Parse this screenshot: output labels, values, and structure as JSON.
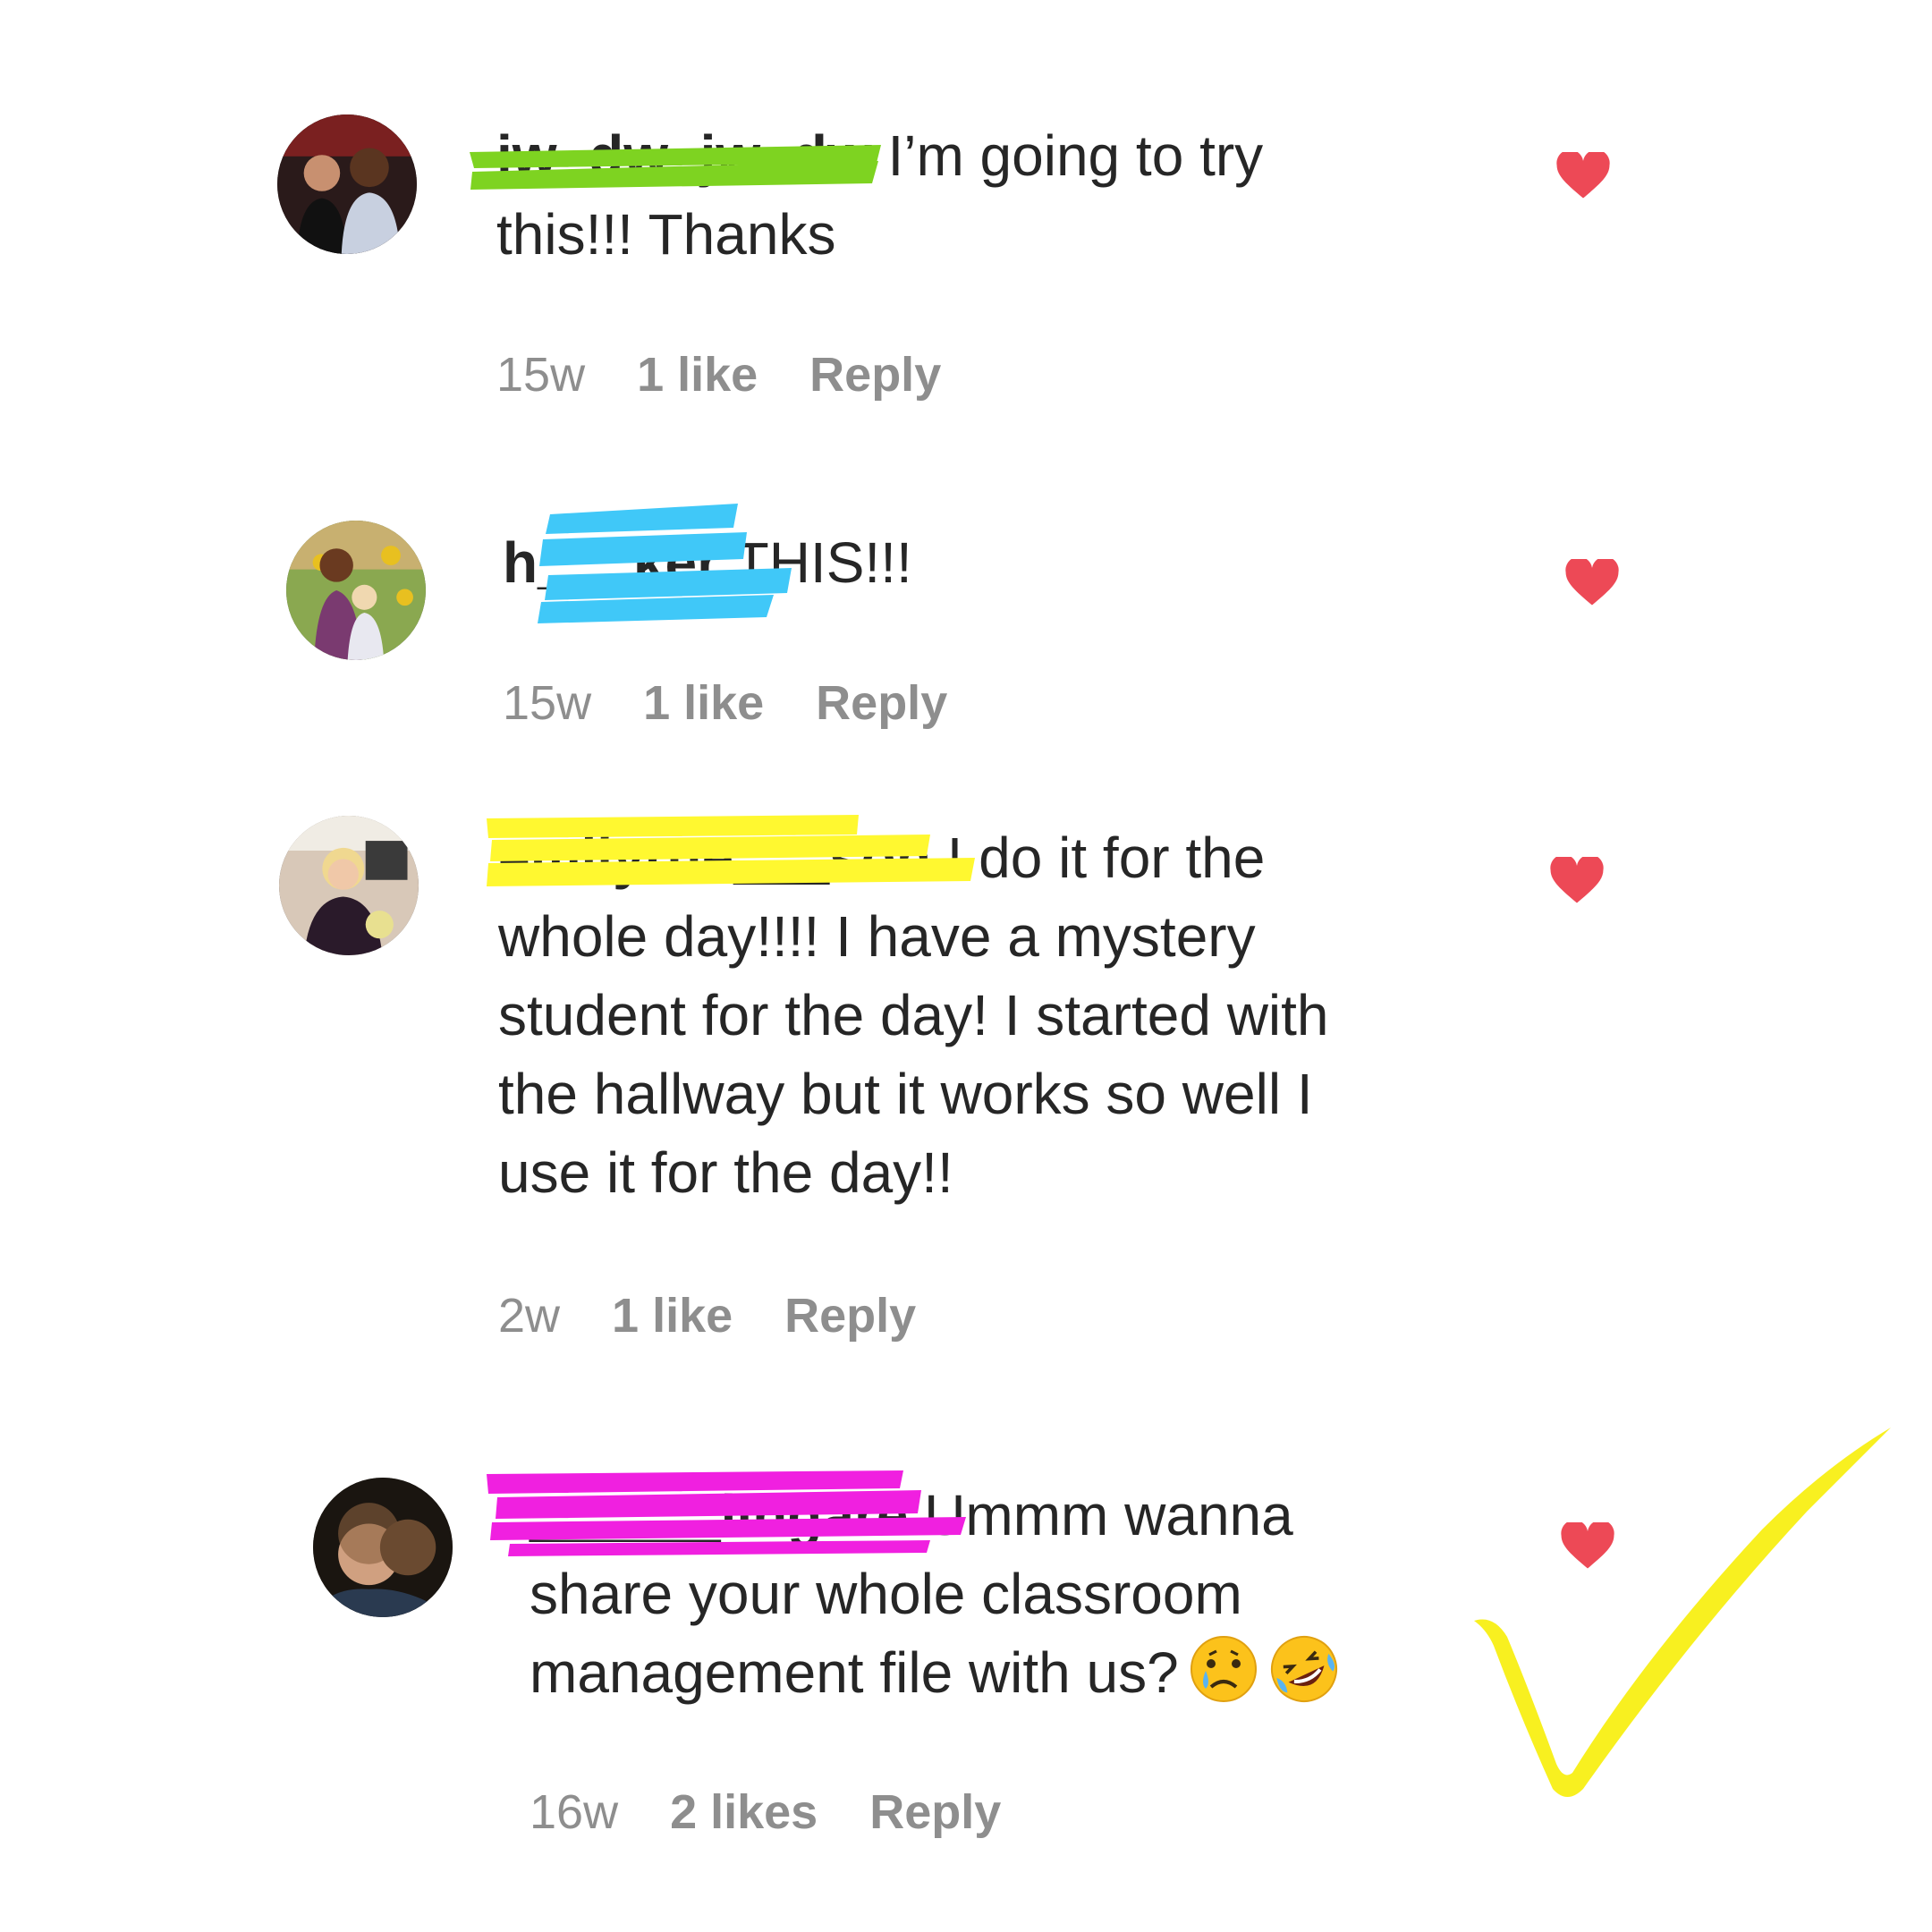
{
  "comments": [
    {
      "username": "jw_dw_jw_dw",
      "text_line1": " I’m going to try",
      "text_line2": "this!!! Thanks",
      "time": "15w",
      "likes": "1 like",
      "reply": "Reply",
      "redaction_color": "#7ed321"
    },
    {
      "username": "h___ker",
      "text_line1": " THIS!!!",
      "time": "15w",
      "likes": "1 like",
      "reply": "Reply",
      "redaction_color": "#40c8f8"
    },
    {
      "username": "emilyrue___son",
      "text_line1": " I do it for the",
      "text_line2": "whole day!!!! I have a mystery",
      "text_line3": "student for the day! I started with",
      "text_line4": "the hallway but it works so well I",
      "text_line5": "use it for the day!!",
      "time": "2w",
      "likes": "1 like",
      "reply": "Reply",
      "redaction_color": "#fff830"
    },
    {
      "username": "______lingare",
      "text_line1": " Ummm wanna",
      "text_line2": "share your whole classroom",
      "text_line3": "management file with us?",
      "time": "16w",
      "likes": "2 likes",
      "reply": "Reply",
      "redaction_color": "#f020e0",
      "emojis": [
        "crying-face-emoji",
        "rolling-on-floor-laughing-emoji"
      ]
    }
  ],
  "icons": {
    "heart": "heart-icon",
    "heart_color": "#ed4956"
  },
  "annotation": {
    "checkmark_color": "#f8f020"
  }
}
